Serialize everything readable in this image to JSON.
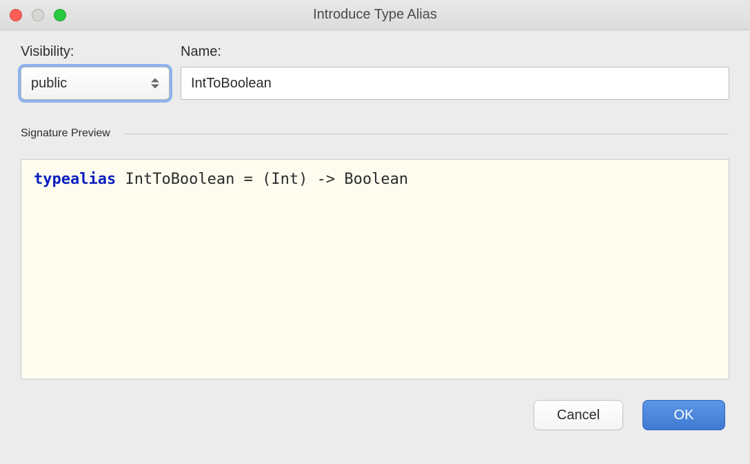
{
  "window": {
    "title": "Introduce Type Alias"
  },
  "labels": {
    "visibility": "Visibility:",
    "name": "Name:",
    "signature_preview": "Signature Preview"
  },
  "form": {
    "visibility": {
      "selected": "public"
    },
    "name": {
      "value": "IntToBoolean"
    }
  },
  "preview": {
    "keyword": "typealias",
    "rest": " IntToBoolean = (Int) -> Boolean"
  },
  "buttons": {
    "cancel": "Cancel",
    "ok": "OK"
  }
}
